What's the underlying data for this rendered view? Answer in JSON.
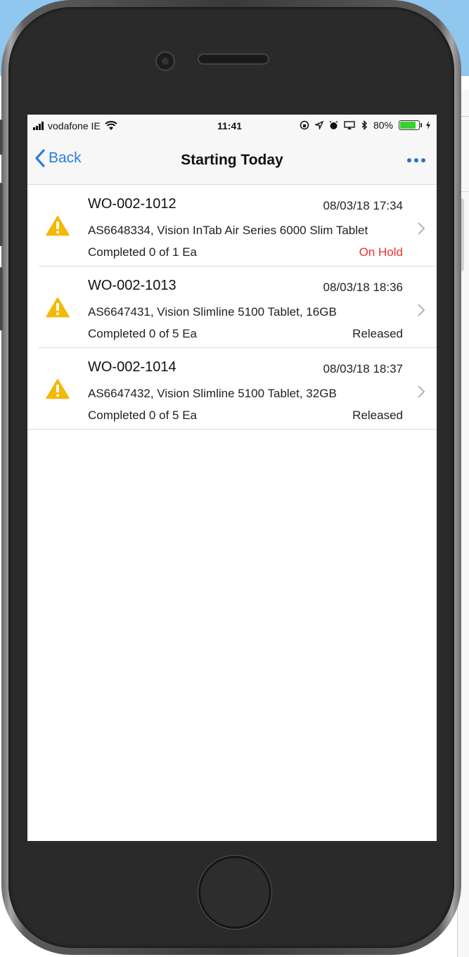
{
  "status_bar": {
    "carrier": "vodafone IE",
    "time": "11:41",
    "battery": "80%"
  },
  "nav": {
    "back_label": "Back",
    "title": "Starting Today"
  },
  "work_orders": [
    {
      "id": "WO-002-1012",
      "datetime": "08/03/18 17:34",
      "description": "AS6648334, Vision InTab Air Series 6000 Slim Tablet",
      "progress": "Completed 0 of 1 Ea",
      "status": "On Hold",
      "status_color": "#e8332f"
    },
    {
      "id": "WO-002-1013",
      "datetime": "08/03/18 18:36",
      "description": "AS6647431, Vision Slimline 5100 Tablet, 16GB",
      "progress": "Completed 0 of 5 Ea",
      "status": "Released",
      "status_color": "#222222"
    },
    {
      "id": "WO-002-1014",
      "datetime": "08/03/18 18:37",
      "description": "AS6647432, Vision Slimline 5100 Tablet, 32GB",
      "progress": "Completed 0 of 5 Ea",
      "status": "Released",
      "status_color": "#222222"
    }
  ],
  "colors": {
    "accent": "#2a7de1",
    "warning": "#f5b800",
    "on_hold": "#e8332f"
  },
  "icons": {
    "row_icon": "warning-triangle-icon",
    "row_chevron": "chevron-right-icon",
    "back": "chevron-left-icon",
    "more": "more-dots-icon"
  }
}
